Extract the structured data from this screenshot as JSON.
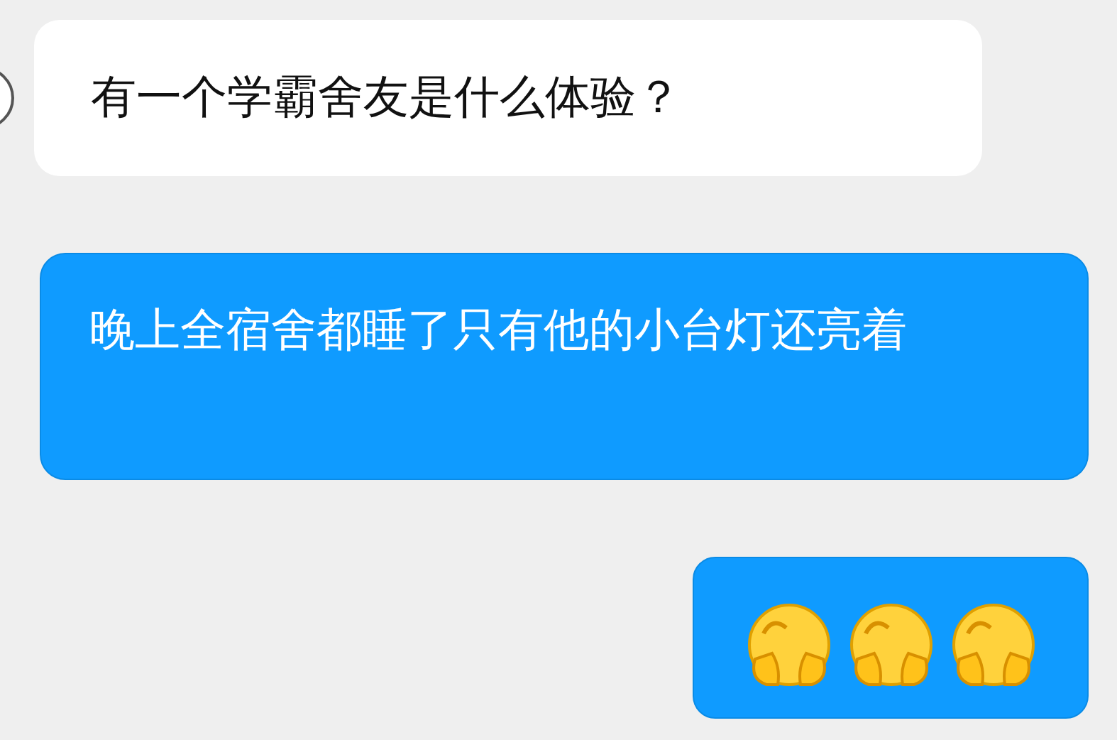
{
  "messages": [
    {
      "kind": "incoming",
      "text": "有一个学霸舍友是什么体验？"
    },
    {
      "kind": "outgoing",
      "text": "晚上全宿舍都睡了只有他的小台灯还亮着"
    },
    {
      "kind": "stickers",
      "items": [
        {
          "kind": "emoji"
        },
        {
          "kind": "emoji"
        },
        {
          "kind": "emoji"
        }
      ]
    }
  ]
}
